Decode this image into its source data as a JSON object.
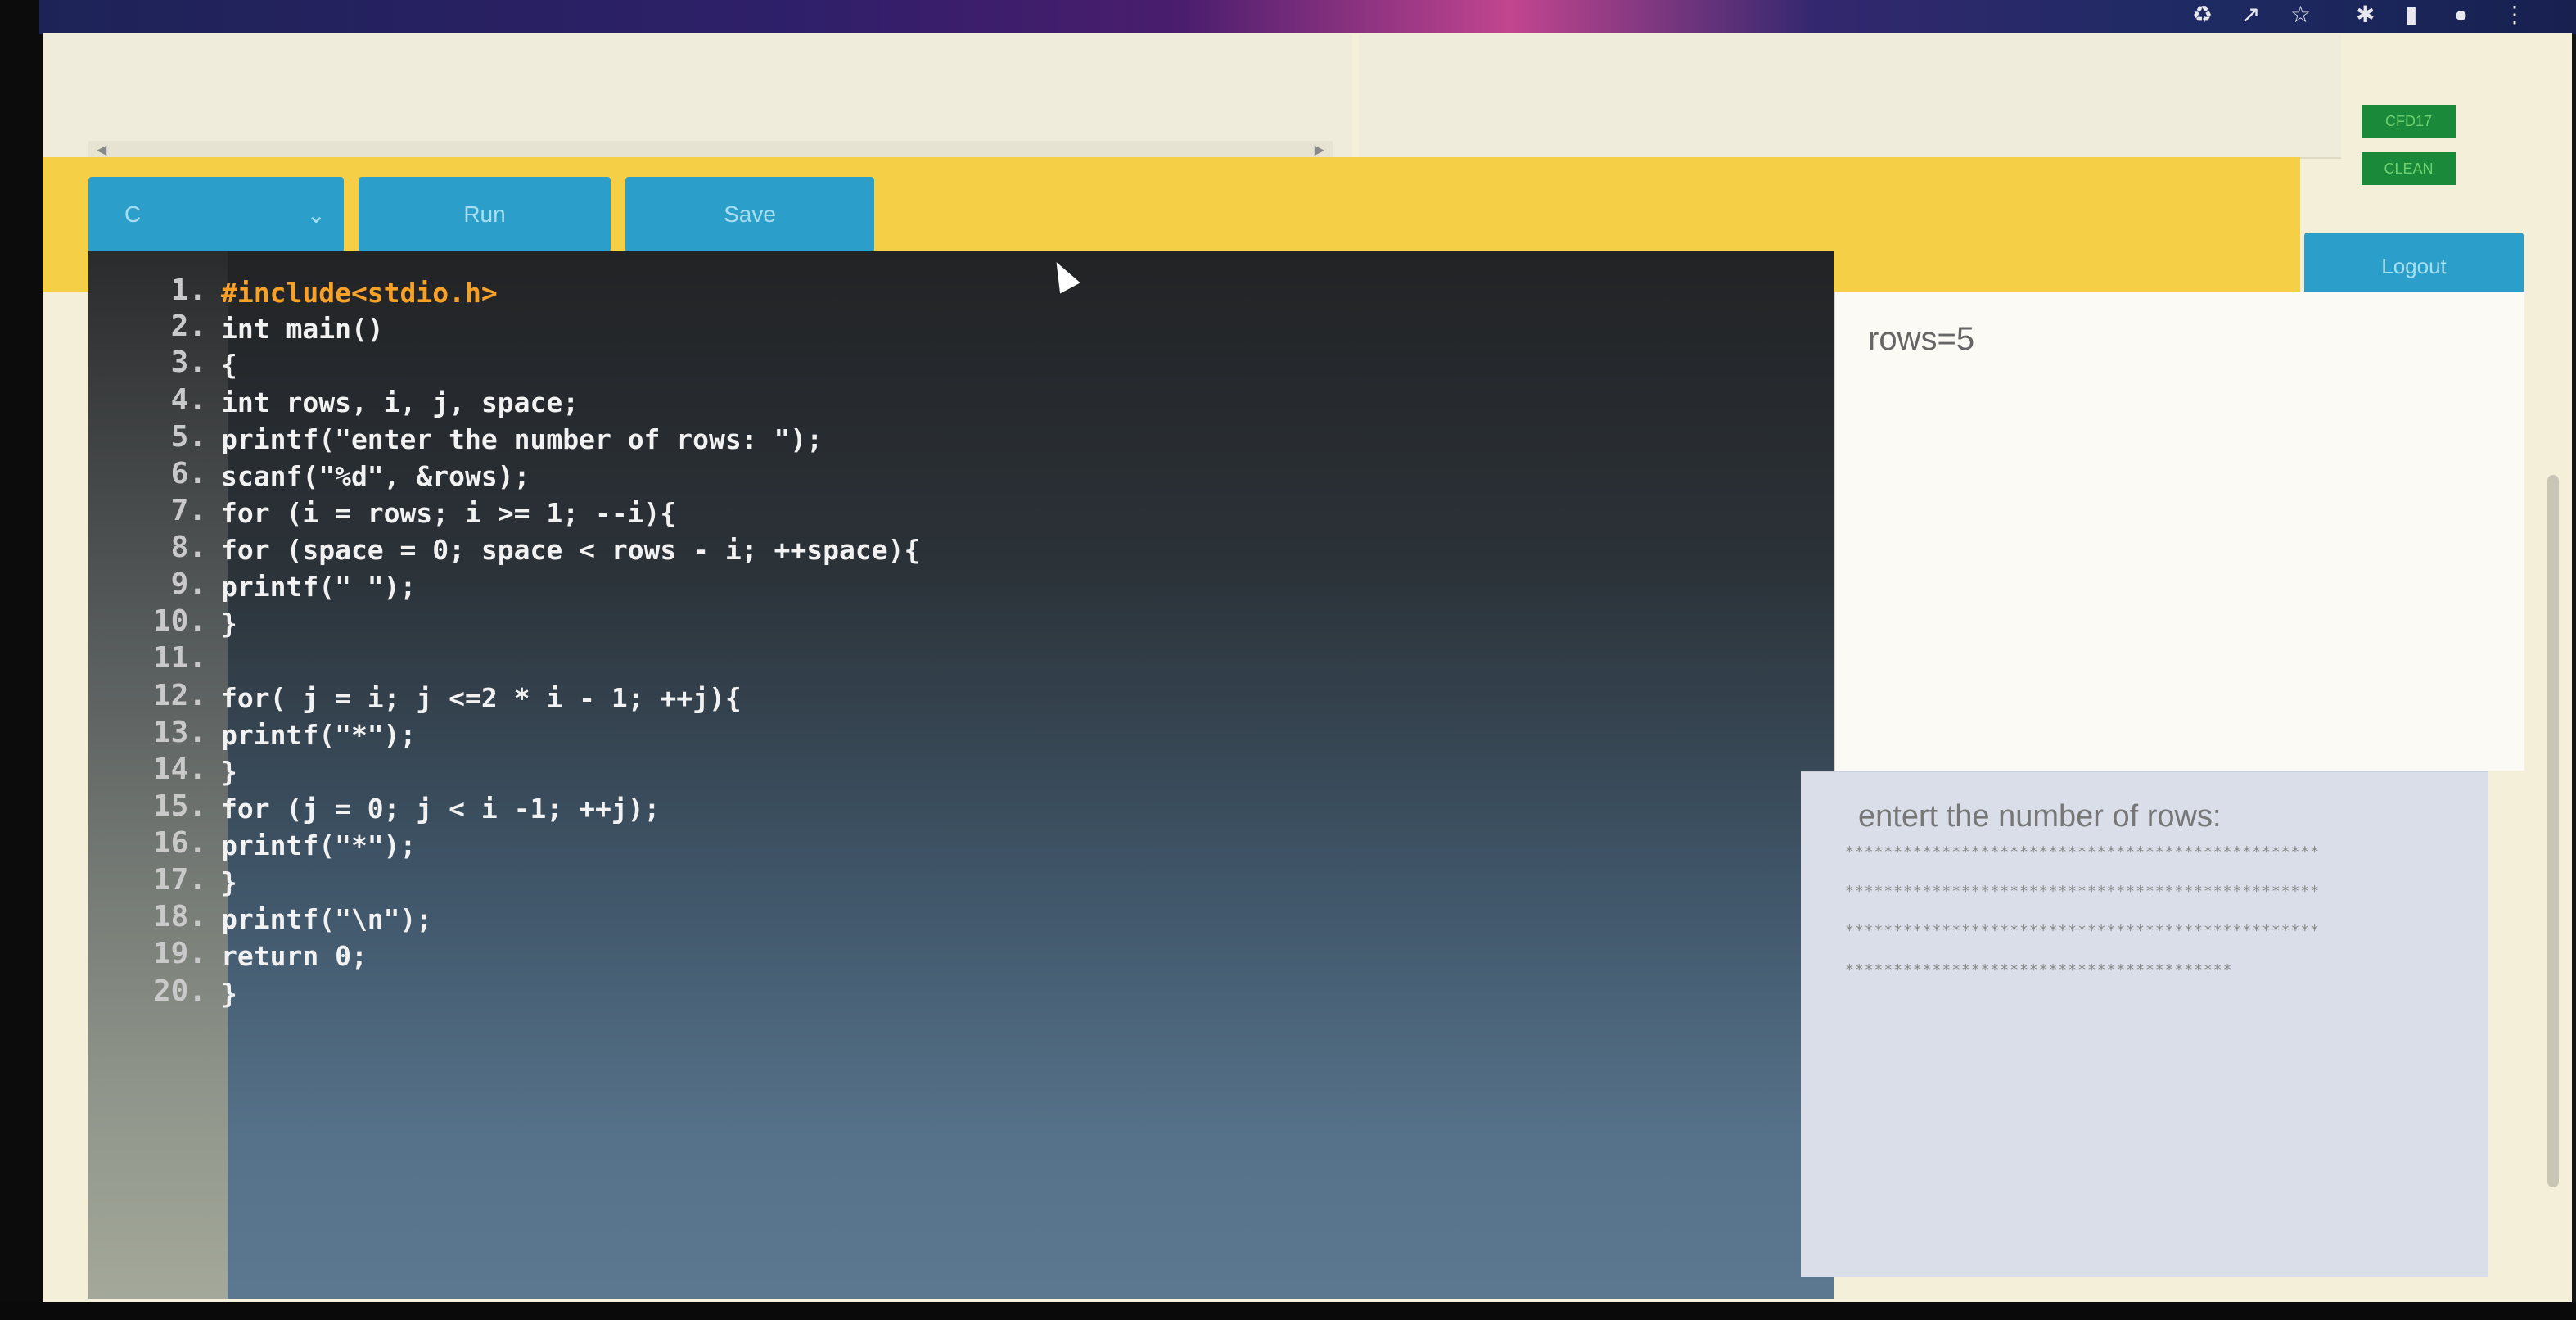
{
  "browser": {
    "toolbar_icons": [
      "share-icon",
      "star-icon",
      "extensions-icon",
      "sidebar-icon",
      "profile-icon",
      "menu-icon"
    ]
  },
  "header": {
    "mini_buttons": [
      "CFD17",
      "CLEAN"
    ]
  },
  "toolbar": {
    "language_value": "C",
    "run_label": "Run",
    "save_label": "Save",
    "logout_label": "Logout"
  },
  "editor": {
    "line_numbers": [
      "1.",
      "2.",
      "3.",
      "4.",
      "5.",
      "6.",
      "7.",
      "8.",
      "9.",
      "10.",
      "11.",
      "12.",
      "13.",
      "14.",
      "15.",
      "16.",
      "17.",
      "18.",
      "19.",
      "20."
    ],
    "lines": [
      "#include<stdio.h>",
      "int main()",
      "{",
      "int rows, i, j, space;",
      "printf(\"enter the number of rows: \");",
      "scanf(\"%d\", &rows);",
      "for (i = rows; i >= 1; --i){",
      "for (space = 0; space < rows - i; ++space){",
      "printf(\" \");",
      "}",
      "",
      "for( j = i; j <=2 * i - 1; ++j){",
      "printf(\"*\");",
      "}",
      "for (j = 0; j < i -1; ++j);",
      "printf(\"*\");",
      "}",
      "printf(\"\\n\");",
      "return 0;",
      "}"
    ]
  },
  "input_panel": {
    "text": "rows=5"
  },
  "output_panel": {
    "prompt": "entert the number of rows:",
    "rows": [
      "*************************************************",
      "*************************************************",
      "*************************************************",
      "****************************************"
    ]
  }
}
